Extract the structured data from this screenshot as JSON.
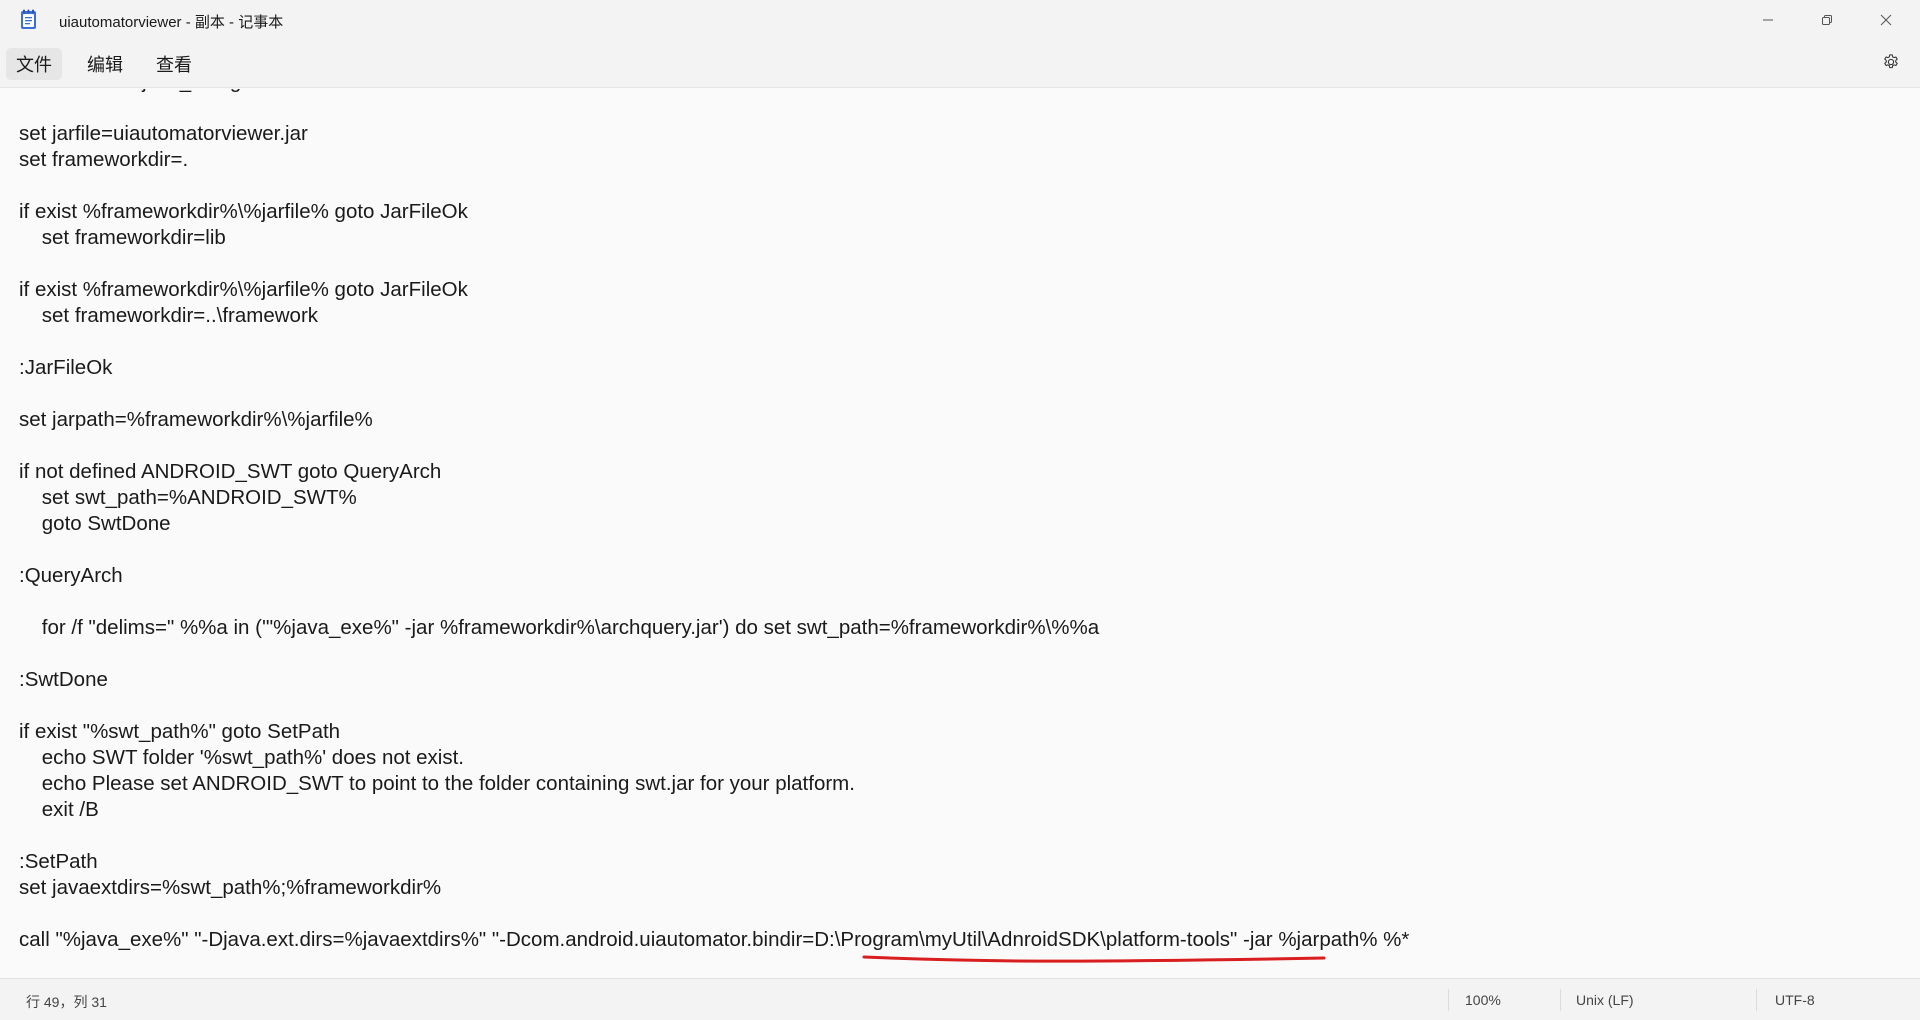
{
  "window": {
    "title": "uiautomatorviewer - 副本 - 记事本",
    "app_icon": "notepad-icon",
    "controls": [
      "minimize-icon",
      "restore-icon",
      "close-icon"
    ]
  },
  "menu": {
    "file": "文件",
    "edit": "编辑",
    "view": "查看",
    "settings_icon": "gear-icon"
  },
  "editor": {
    "lines": [
      "if not defined java_exe goto :EOF",
      "",
      "set jarfile=uiautomatorviewer.jar",
      "set frameworkdir=.",
      "",
      "if exist %frameworkdir%\\%jarfile% goto JarFileOk",
      "    set frameworkdir=lib",
      "",
      "if exist %frameworkdir%\\%jarfile% goto JarFileOk",
      "    set frameworkdir=..\\framework",
      "",
      ":JarFileOk",
      "",
      "set jarpath=%frameworkdir%\\%jarfile%",
      "",
      "if not defined ANDROID_SWT goto QueryArch",
      "    set swt_path=%ANDROID_SWT%",
      "    goto SwtDone",
      "",
      ":QueryArch",
      "",
      "    for /f \"delims=\" %%a in ('\"%java_exe%\" -jar %frameworkdir%\\archquery.jar') do set swt_path=%frameworkdir%\\%%a",
      "",
      ":SwtDone",
      "",
      "if exist \"%swt_path%\" goto SetPath",
      "    echo SWT folder '%swt_path%' does not exist.",
      "    echo Please set ANDROID_SWT to point to the folder containing swt.jar for your platform.",
      "    exit /B",
      "",
      ":SetPath",
      "set javaextdirs=%swt_path%;%frameworkdir%",
      "",
      "call \"%java_exe%\" \"-Djava.ext.dirs=%javaextdirs%\" \"-Dcom.android.uiautomator.bindir=D:\\Program\\myUtil\\AdnroidSDK\\platform-tools\" -jar %jarpath% %*"
    ],
    "annotation_color": "#d81e1e"
  },
  "status": {
    "position": "行 49，列 31",
    "zoom": "100%",
    "line_ending": "Unix (LF)",
    "encoding": "UTF-8"
  }
}
